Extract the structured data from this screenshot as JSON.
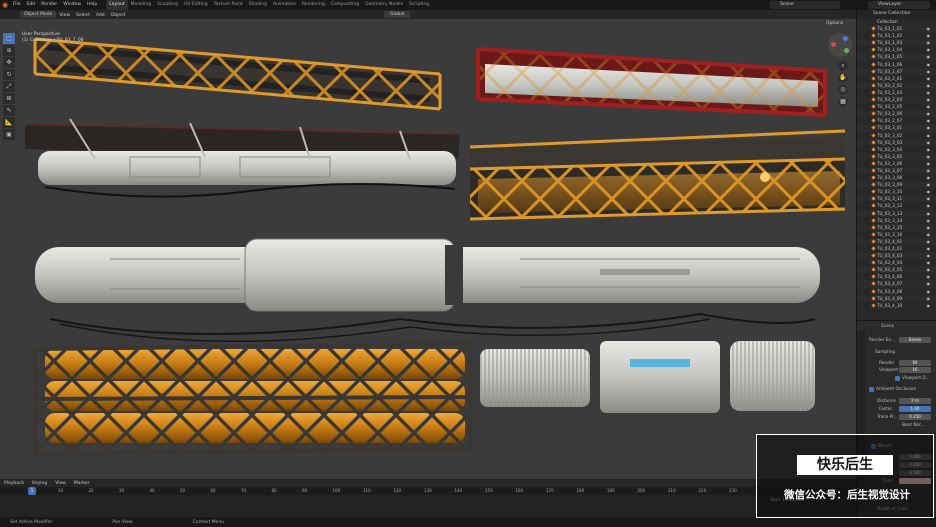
{
  "app": {
    "menu": [
      "File",
      "Edit",
      "Render",
      "Window",
      "Help"
    ],
    "workspaces": [
      "Layout",
      "Modeling",
      "Sculpting",
      "UV Editing",
      "Texture Paint",
      "Shading",
      "Animation",
      "Rendering",
      "Compositing",
      "Geometry Nodes",
      "Scripting"
    ],
    "active_workspace": "Layout",
    "scene": "Scene",
    "view_layer": "ViewLayer"
  },
  "viewport": {
    "mode": "Object Mode",
    "menus": [
      "View",
      "Select",
      "Add",
      "Object"
    ],
    "transform": "Global",
    "info_line1": "User Perspective",
    "info_line2": "(1) Collection | TU_03_7_08",
    "options": "Options"
  },
  "outliner": {
    "header": "Scene Collection",
    "collection": "Collection",
    "items": [
      "TU_03_1_01",
      "TU_03_1_02",
      "TU_03_1_03",
      "TU_03_1_04",
      "TU_03_1_05",
      "TU_03_1_06",
      "TU_03_1_07",
      "TU_03_2_01",
      "TU_03_2_02",
      "TU_03_2_03",
      "TU_03_2_04",
      "TU_03_2_05",
      "TU_03_2_06",
      "TU_03_2_07",
      "TU_03_3_01",
      "TU_03_3_02",
      "TU_03_3_03",
      "TU_03_3_04",
      "TU_03_3_05",
      "TU_03_3_06",
      "TU_03_3_07",
      "TU_03_3_08",
      "TU_03_3_09",
      "TU_03_3_10",
      "TU_03_3_11",
      "TU_03_3_12",
      "TU_03_3_13",
      "TU_03_3_14",
      "TU_03_3_15",
      "TU_03_3_16",
      "TU_03_4_01",
      "TU_03_4_02",
      "TU_03_4_03",
      "TU_03_4_04",
      "TU_03_4_05",
      "TU_03_4_06",
      "TU_03_4_07",
      "TU_03_4_08",
      "TU_03_4_09",
      "TU_03_4_10"
    ]
  },
  "properties": {
    "tab_title": "Scene",
    "render_engine_label": "Render En...",
    "render_engine": "Eevee",
    "sampling": "Sampling",
    "render_label": "Render",
    "render_value": "64",
    "viewport_label": "Viewport",
    "viewport_value": "16",
    "viewport_denoise": "Viewport D...",
    "ao": "Ambient Occlusion",
    "distance_label": "Distance",
    "distance_value": "2 m",
    "factor_label": "Factor",
    "factor_value": "1.00",
    "trace_label": "Trace Pr...",
    "trace_value": "0.250",
    "bent_normals": "Bent Nor...",
    "bloom": "Bloom",
    "bloom_v1": "0.800",
    "bloom_v2": "0.050",
    "bloom_v3": "6.500",
    "color_label": "Color",
    "dof": "Depth of Field"
  },
  "timeline": {
    "menus": [
      "Playback",
      "Keying",
      "View",
      "Marker"
    ],
    "current_frame": "1",
    "ticks": [
      "10",
      "20",
      "30",
      "40",
      "50",
      "60",
      "70",
      "80",
      "90",
      "100",
      "110",
      "120",
      "130",
      "140",
      "150",
      "160",
      "170",
      "180",
      "190",
      "200",
      "210",
      "220",
      "230"
    ],
    "start_label": "Start",
    "start_value": "1",
    "end_label": "End",
    "end_value": "250"
  },
  "status": {
    "left": "Set Active Modifier",
    "middle": "Pan View",
    "right": "Context Menu"
  },
  "watermark": {
    "line1": "快乐后生",
    "line2": "微信公众号：后生视觉设计"
  },
  "colors": {
    "accent": "#4772b3",
    "orange_frame": "#d89224",
    "red_frame": "#8a1f1f",
    "metal": "#c8c8c4"
  }
}
